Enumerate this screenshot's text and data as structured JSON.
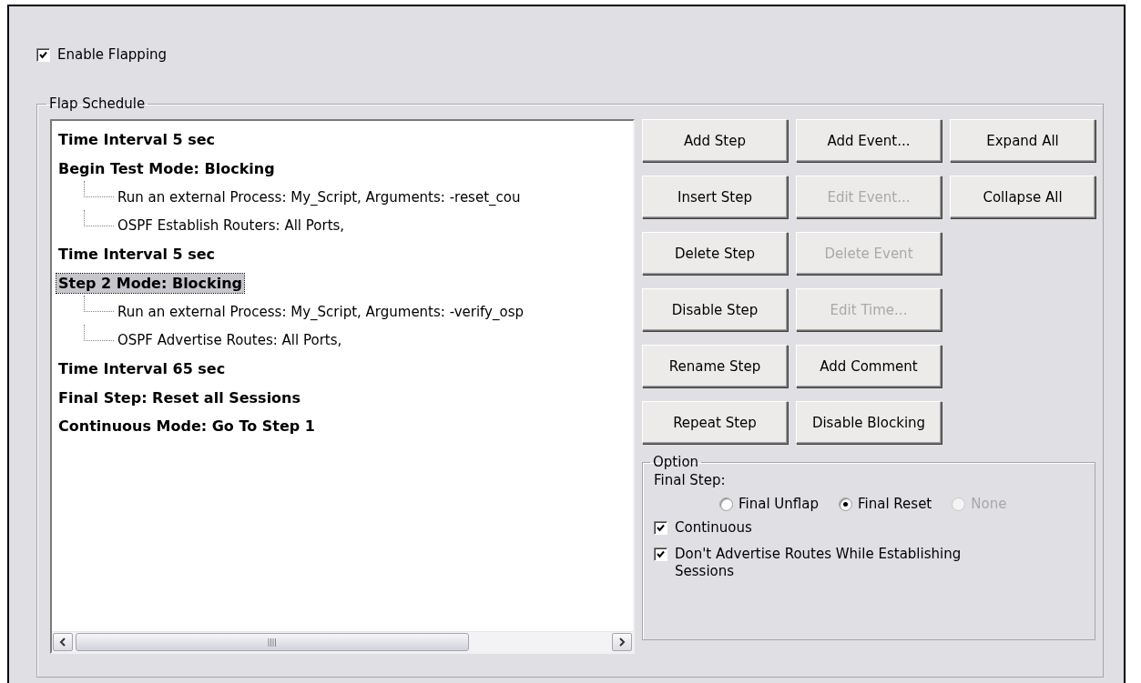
{
  "enable_flapping": {
    "label": "Enable Flapping",
    "checked": true
  },
  "flap_schedule": {
    "title": "Flap Schedule",
    "tree": [
      {
        "label": "Time Interval 5 sec",
        "selected": false
      },
      {
        "label": "Begin Test Mode: Blocking",
        "selected": false,
        "children": [
          {
            "label": "Run an external Process: My_Script, Arguments: -reset_cou",
            "selected": false
          },
          {
            "label": "OSPF Establish Routers: All Ports,",
            "selected": false
          }
        ]
      },
      {
        "label": "Time Interval 5 sec",
        "selected": false
      },
      {
        "label": "Step 2 Mode: Blocking",
        "selected": true,
        "children": [
          {
            "label": "Run an external Process: My_Script, Arguments: -verify_osp",
            "selected": false
          },
          {
            "label": "OSPF Advertise Routes: All Ports,",
            "selected": false
          }
        ]
      },
      {
        "label": "Time Interval 65 sec",
        "selected": false
      },
      {
        "label": "Final Step: Reset all Sessions",
        "selected": false
      },
      {
        "label": "Continuous Mode: Go To Step 1",
        "selected": false
      }
    ],
    "button_columns": [
      [
        {
          "label": "Add Step",
          "disabled": false
        },
        {
          "label": "Insert Step",
          "disabled": false
        },
        {
          "label": "Delete Step",
          "disabled": false
        },
        {
          "label": "Disable Step",
          "disabled": false
        },
        {
          "label": "Rename Step",
          "disabled": false
        },
        {
          "label": "Repeat Step",
          "disabled": false
        }
      ],
      [
        {
          "label": "Add Event...",
          "disabled": false
        },
        {
          "label": "Edit Event...",
          "disabled": true
        },
        {
          "label": "Delete Event",
          "disabled": true
        },
        {
          "label": "Edit Time...",
          "disabled": true
        },
        {
          "label": "Add Comment",
          "disabled": false
        },
        {
          "label": "Disable Blocking",
          "disabled": false
        }
      ],
      [
        {
          "label": "Expand All",
          "disabled": false
        },
        {
          "label": "Collapse All",
          "disabled": false
        }
      ]
    ],
    "option": {
      "title": "Option",
      "final_step_label": "Final Step:",
      "radios": [
        {
          "label": "Final Unflap",
          "selected": false,
          "disabled": false
        },
        {
          "label": "Final Reset",
          "selected": true,
          "disabled": false
        },
        {
          "label": "None",
          "selected": false,
          "disabled": true
        }
      ],
      "checkboxes": [
        {
          "label": "Continuous",
          "checked": true
        },
        {
          "label": "Don't Advertise Routes While Establishing Sessions",
          "checked": true
        }
      ]
    }
  }
}
